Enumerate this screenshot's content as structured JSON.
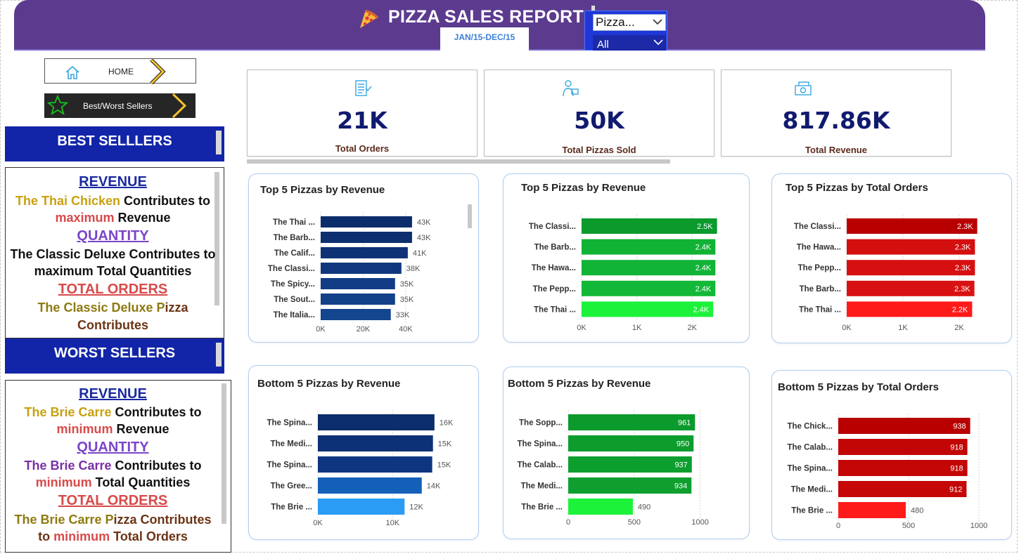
{
  "header": {
    "title": "PIZZA SALES REPORT",
    "date_range": "JAN/15-DEC/15",
    "slicer_top": "Pizza...",
    "slicer_bottom": "All"
  },
  "nav": {
    "home_label": "HOME",
    "best_worst_label": "Best/Worst Sellers"
  },
  "best": {
    "banner": "BEST SELLLERS",
    "revenue_heading": "REVENUE",
    "revenue_l1a": "The Thai Chicken",
    "revenue_l1b": " Contributes to",
    "revenue_l2a": "maximum",
    "revenue_l2b": " Revenue",
    "quantity_heading": "QUANTITY ",
    "quantity_l1": "The Classic Deluxe Contributes to",
    "quantity_l2": "maximum Total Quantities",
    "orders_heading": "TOTAL ORDERS",
    "orders_l1a": "The Classic Deluxe P",
    "orders_l1b": "izza",
    "orders_l2": "Contributes"
  },
  "worst": {
    "banner": "WORST SELLERS",
    "revenue_heading": "REVENUE",
    "revenue_l1a": "The Brie Carre",
    "revenue_l1b": " Contributes to",
    "revenue_l2a": "minimum",
    "revenue_l2b": " Revenue",
    "quantity_heading": "QUANTITY ",
    "quantity_l1a": "The Brie Carre",
    "quantity_l1b": " Contributes to",
    "quantity_l2a": "minimum",
    "quantity_l2b": " Total Quantities",
    "orders_heading": "TOTAL ORDERS",
    "orders_l1a": "The Brie Carre P",
    "orders_l1b": "izza Contributes",
    "orders_l2a": "to ",
    "orders_l2b": "minimum",
    "orders_l2c": " Total Orders"
  },
  "kpis": [
    {
      "value": "21K",
      "label": "Total Orders",
      "icon": "order-list-icon"
    },
    {
      "value": "50K",
      "label": "Total Pizzas Sold",
      "icon": "delivery-person-icon"
    },
    {
      "value": "817.86K",
      "label": "Total Revenue",
      "icon": "cash-icon"
    }
  ],
  "colors": {
    "header": "#5c3b8f",
    "banner": "#1225a8",
    "navy": "#0c2d6b",
    "green": "#0b9a2c",
    "red": "#c00000"
  },
  "chart_data": [
    {
      "type": "bar",
      "orientation": "horizontal",
      "title": "Top 5 Pizzas by Revenue",
      "categories": [
        "The Thai ...",
        "The Barb...",
        "The Calif...",
        "The Classi...",
        "The Spicy...",
        "The Sout...",
        "The Italia..."
      ],
      "values": [
        43,
        43,
        41,
        38,
        35,
        35,
        33
      ],
      "data_labels": [
        "43K",
        "43K",
        "41K",
        "38K",
        "35K",
        "35K",
        "33K"
      ],
      "xlim": [
        0,
        47
      ],
      "ticks": [
        0,
        20,
        40
      ],
      "tick_labels": [
        "0K",
        "20K",
        "40K"
      ],
      "colors": [
        "#0c2d6b",
        "#0d2f70",
        "#0e3275",
        "#10377d",
        "#123c86",
        "#134088",
        "#14458f"
      ]
    },
    {
      "type": "bar",
      "orientation": "horizontal",
      "title": "Top 5 Pizzas by Revenue",
      "categories": [
        "The Classi...",
        "The Barb...",
        "The Hawa...",
        "The Pepp...",
        "The Thai ..."
      ],
      "values": [
        2.45,
        2.42,
        2.42,
        2.42,
        2.38
      ],
      "data_labels": [
        "2.5K",
        "2.4K",
        "2.4K",
        "2.4K",
        "2.4K"
      ],
      "xlim": [
        0,
        2.9
      ],
      "ticks": [
        0,
        1,
        2
      ],
      "tick_labels": [
        "0K",
        "1K",
        "2K"
      ],
      "colors": [
        "#0b9a2c",
        "#10b334",
        "#11b436",
        "#12b837",
        "#1df23b"
      ]
    },
    {
      "type": "bar",
      "orientation": "horizontal",
      "title": "Top 5 Pizzas by Total Orders",
      "categories": [
        "The Classi...",
        "The Hawa...",
        "The Pepp...",
        "The Barb...",
        "The Thai ..."
      ],
      "values": [
        2.32,
        2.28,
        2.28,
        2.27,
        2.23
      ],
      "data_labels": [
        "2.3K",
        "2.3K",
        "2.3K",
        "2.3K",
        "2.2K"
      ],
      "xlim": [
        0,
        2.5
      ],
      "ticks": [
        0,
        1,
        2
      ],
      "tick_labels": [
        "0K",
        "1K",
        "2K"
      ],
      "colors": [
        "#b80000",
        "#d40f0f",
        "#d61010",
        "#d81212",
        "#ff1a1a"
      ]
    },
    {
      "type": "bar",
      "orientation": "horizontal",
      "title": "Bottom 5 Pizzas by Revenue",
      "categories": [
        "The Spina...",
        "The Medi...",
        "The Spina...",
        "The Gree...",
        "The Brie ..."
      ],
      "values": [
        15.6,
        15.4,
        15.3,
        13.9,
        11.6
      ],
      "data_labels": [
        "16K",
        "15K",
        "15K",
        "14K",
        "12K"
      ],
      "xlim": [
        0,
        17.5
      ],
      "ticks": [
        0,
        10
      ],
      "tick_labels": [
        "0K",
        "10K"
      ],
      "colors": [
        "#0c2d6b",
        "#0d3176",
        "#0e3680",
        "#1460b8",
        "#2a9cf5"
      ]
    },
    {
      "type": "bar",
      "orientation": "horizontal",
      "title": "Bottom 5 Pizzas by Revenue",
      "categories": [
        "The Sopp...",
        "The Spina...",
        "The Calab...",
        "The Medi...",
        "The Brie ..."
      ],
      "values": [
        961,
        950,
        937,
        934,
        490
      ],
      "data_labels": [
        "961",
        "950",
        "937",
        "934",
        "490"
      ],
      "xlim": [
        0,
        1050
      ],
      "ticks": [
        0,
        500,
        1000
      ],
      "tick_labels": [
        "0",
        "500",
        "1000"
      ],
      "colors": [
        "#0b9a2c",
        "#0c9d2d",
        "#0d9f2e",
        "#0e9f2f",
        "#1df23b"
      ]
    },
    {
      "type": "bar",
      "orientation": "horizontal",
      "title": "Bottom 5 Pizzas by Total Orders",
      "categories": [
        "The Chick...",
        "The Calab...",
        "The Spina...",
        "The Medi...",
        "The Brie ..."
      ],
      "values": [
        938,
        918,
        918,
        912,
        480
      ],
      "data_labels": [
        "938",
        "918",
        "918",
        "912",
        "480"
      ],
      "xlim": [
        0,
        1000
      ],
      "ticks": [
        0,
        500,
        1000
      ],
      "tick_labels": [
        "0",
        "500",
        "1000"
      ],
      "colors": [
        "#b80000",
        "#c20505",
        "#c40606",
        "#c50707",
        "#ff1a1a"
      ]
    }
  ]
}
